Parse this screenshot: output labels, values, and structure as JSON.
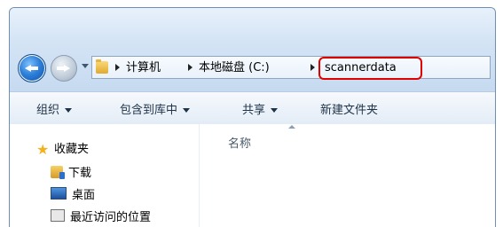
{
  "address": {
    "crumbs": [
      "计算机",
      "本地磁盘 (C:)",
      "scannerdata"
    ]
  },
  "toolbar": {
    "organize": "组织",
    "include_in_library": "包含到库中",
    "share": "共享",
    "new_folder": "新建文件夹"
  },
  "sidebar": {
    "favorites": "收藏夹",
    "items": [
      {
        "label": "下载",
        "icon": "downloads-folder-icon"
      },
      {
        "label": "桌面",
        "icon": "desktop-icon"
      },
      {
        "label": "最近访问的位置",
        "icon": "recent-places-icon"
      }
    ]
  },
  "content": {
    "column_name": "名称"
  },
  "colors": {
    "highlight": "#e00000",
    "nav_bg": "#d4e4f5"
  }
}
